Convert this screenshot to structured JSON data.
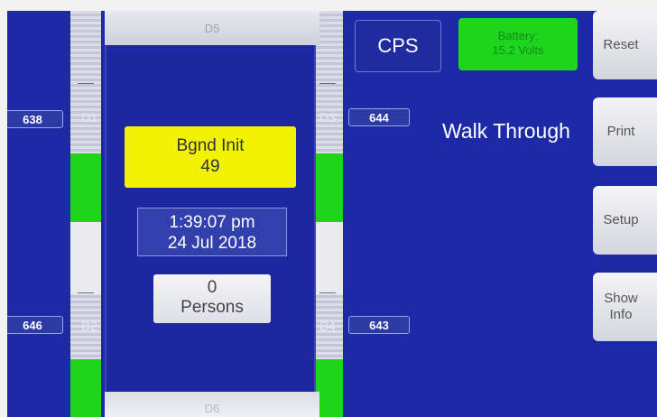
{
  "colors": {
    "screen_bg": "#1c2aa8",
    "green": "#1ed51e",
    "yellow": "#f2f205"
  },
  "top_label": "D5",
  "bottom_label": "D6",
  "detectors": {
    "d1": {
      "label": "D1",
      "count": "638"
    },
    "d2": {
      "label": "D2",
      "count": "646"
    },
    "d3": {
      "label": "D3",
      "count": "644"
    },
    "d4": {
      "label": "D4",
      "count": "643"
    }
  },
  "status": {
    "line1": "Bgnd Init",
    "line2": "49"
  },
  "clock": {
    "time": "1:39:07 pm",
    "date": "24 Jul 2018"
  },
  "persons": {
    "count": "0",
    "label": "Persons"
  },
  "mode": {
    "cps_label": "CPS",
    "title": "Walk Through"
  },
  "battery": {
    "line1": "Battery:",
    "line2": "15.2 Volts"
  },
  "buttons": {
    "reset": "Reset",
    "print": "Print",
    "setup": "Setup",
    "show_info_1": "Show",
    "show_info_2": "Info"
  }
}
